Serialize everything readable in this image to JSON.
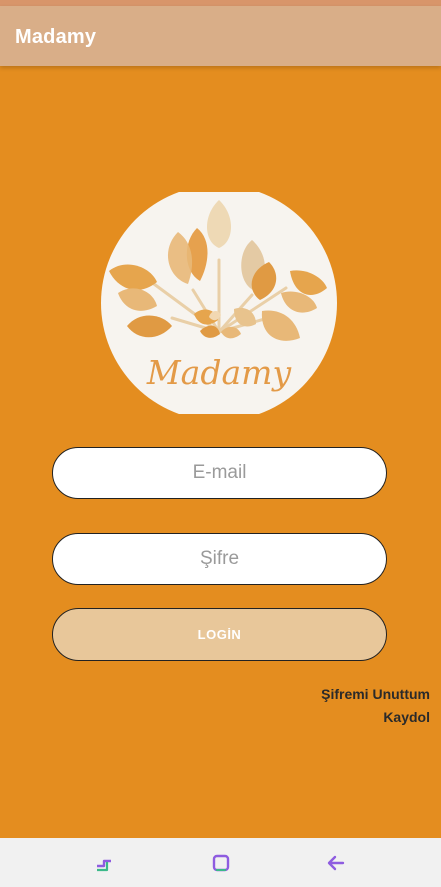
{
  "app": {
    "title": "Madamy"
  },
  "logo": {
    "text": "Madamy"
  },
  "login_form": {
    "email_placeholder": "E-mail",
    "password_placeholder": "Şifre",
    "login_label": "LOGİN"
  },
  "links": {
    "forgot_password": "Şifremi Unuttum",
    "register": "Kaydol"
  },
  "nav": {
    "icons": [
      "recent-apps-icon",
      "home-icon",
      "back-icon"
    ]
  },
  "colors": {
    "background": "#E48D1F",
    "app_bar": "#D9AE88",
    "button": "#E8C79A",
    "logo_circle": "#F7F4EF",
    "nav_bar": "#F1F1F1"
  }
}
